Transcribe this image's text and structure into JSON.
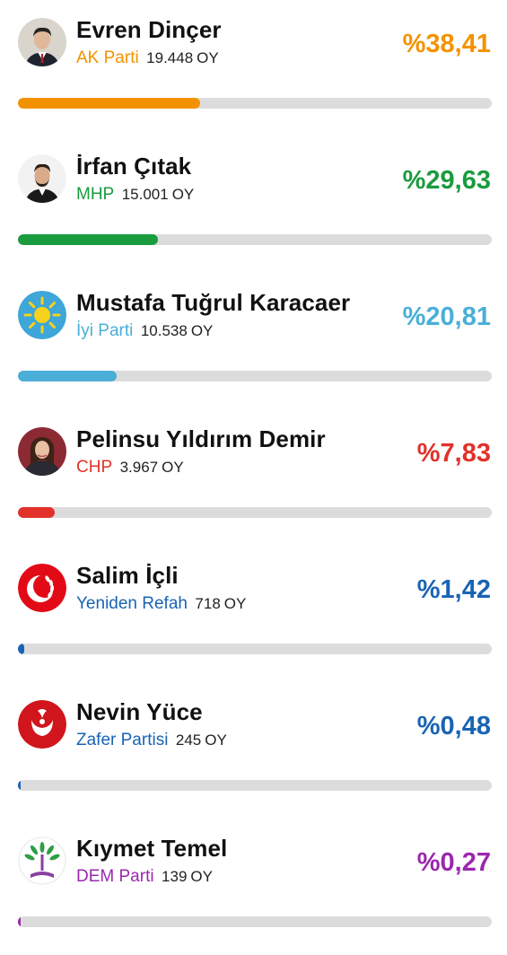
{
  "candidates": [
    {
      "name": "Evren Dinçer",
      "party": "AK Parti",
      "votes": "19.448",
      "vote_unit": "OY",
      "percent_label": "%38,41",
      "percent_value": 38.41,
      "color": "#f39200",
      "avatar": "candidate-photo"
    },
    {
      "name": "İrfan Çıtak",
      "party": "MHP",
      "votes": "15.001",
      "vote_unit": "OY",
      "percent_label": "%29,63",
      "percent_value": 29.63,
      "color": "#1a9b3e",
      "avatar": "candidate-photo"
    },
    {
      "name": "Mustafa Tuğrul Karacaer",
      "party": "İyi Parti",
      "votes": "10.538",
      "vote_unit": "OY",
      "percent_label": "%20,81",
      "percent_value": 20.81,
      "color": "#4aaed8",
      "avatar": "iyi-parti-sun-logo"
    },
    {
      "name": "Pelinsu Yıldırım Demir",
      "party": "CHP",
      "votes": "3.967",
      "vote_unit": "OY",
      "percent_label": "%7,83",
      "percent_value": 7.83,
      "color": "#e2312a",
      "avatar": "candidate-photo"
    },
    {
      "name": "Salim İçli",
      "party": "Yeniden Refah",
      "votes": "718",
      "vote_unit": "OY",
      "percent_label": "%1,42",
      "percent_value": 1.42,
      "color": "#1864b4",
      "avatar": "yeniden-refah-crescent-logo"
    },
    {
      "name": "Nevin Yüce",
      "party": "Zafer Partisi",
      "votes": "245",
      "vote_unit": "OY",
      "percent_label": "%0,48",
      "percent_value": 0.48,
      "color": "#1864b4",
      "avatar": "zafer-partisi-logo"
    },
    {
      "name": "Kıymet Temel",
      "party": "DEM Parti",
      "votes": "139",
      "vote_unit": "OY",
      "percent_label": "%0,27",
      "percent_value": 0.27,
      "color": "#9b27af",
      "avatar": "dem-parti-logo"
    }
  ]
}
